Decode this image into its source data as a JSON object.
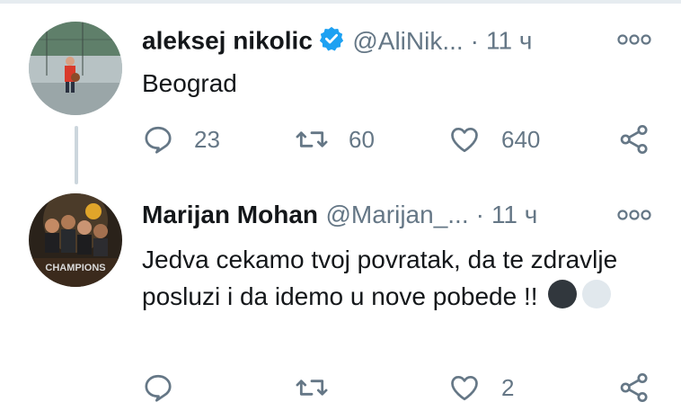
{
  "colors": {
    "text": "#14171a",
    "secondary": "#657786",
    "verified": "#1da1f2",
    "thread_line": "#ccd6dd"
  },
  "tweets": [
    {
      "display_name": "aleksej nikolic",
      "verified": true,
      "handle": "@AliNik...",
      "separator": "·",
      "time": "11 ч",
      "text": "Beograd",
      "reply_count": "23",
      "retweet_count": "60",
      "like_count": "640"
    },
    {
      "display_name": "Marijan Mohan",
      "verified": false,
      "handle": "@Marijan_...",
      "separator": "·",
      "time": "11 ч",
      "text": "Jedva cekamo tvoj povratak, da te zdravlje posluzi i da idemo u nove pobede !!",
      "emojis": [
        "black-circle",
        "white-circle"
      ],
      "reply_count": "",
      "retweet_count": "",
      "like_count": "2"
    }
  ],
  "avatar_2_caption": "CHAMPIONS",
  "icons": {
    "more": "more-icon",
    "reply": "reply-icon",
    "retweet": "retweet-icon",
    "like": "heart-icon",
    "share": "share-icon",
    "verified": "verified-badge-icon"
  }
}
